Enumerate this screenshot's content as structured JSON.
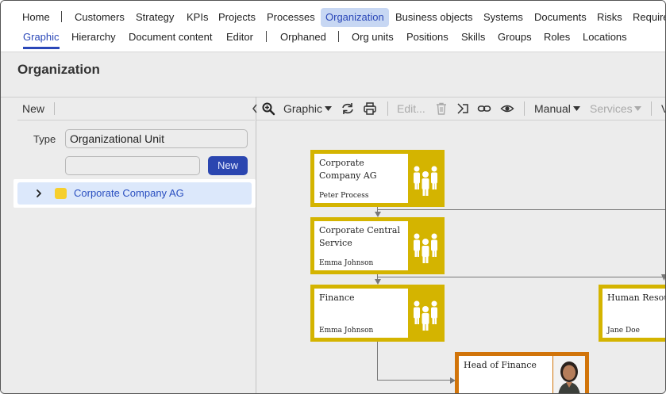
{
  "nav": {
    "main_items": [
      {
        "label": "Home"
      },
      {
        "label": "Customers"
      },
      {
        "label": "Strategy"
      },
      {
        "label": "KPIs"
      },
      {
        "label": "Projects"
      },
      {
        "label": "Processes"
      },
      {
        "label": "Organization",
        "active": true
      },
      {
        "label": "Business objects"
      },
      {
        "label": "Systems"
      },
      {
        "label": "Documents"
      },
      {
        "label": "Risks"
      },
      {
        "label": "Require"
      }
    ],
    "sub_items": [
      {
        "label": "Graphic",
        "active": true
      },
      {
        "label": "Hierarchy"
      },
      {
        "label": "Document content"
      },
      {
        "label": "Editor"
      },
      {
        "label": "Orphaned"
      },
      {
        "label": "Org units"
      },
      {
        "label": "Positions"
      },
      {
        "label": "Skills"
      },
      {
        "label": "Groups"
      },
      {
        "label": "Roles"
      },
      {
        "label": "Locations"
      }
    ]
  },
  "page": {
    "title": "Organization"
  },
  "left_panel": {
    "new_label": "New",
    "type_label": "Type",
    "type_value": "Organizational Unit",
    "name_value": "",
    "new_button": "New",
    "tree": [
      {
        "label": "Corporate Company AG",
        "color": "#f6cf2e"
      }
    ]
  },
  "toolbar": {
    "view_label": "Graphic",
    "edit_label": "Edit...",
    "layout_label": "Manual",
    "services_label": "Services"
  },
  "diagram": {
    "nodes": [
      {
        "name": "Corporate Company AG",
        "person": "Peter Process",
        "icon": "people-group-icon"
      },
      {
        "name": "Corporate Central Service",
        "person": "Emma Johnson",
        "icon": "people-group-icon"
      },
      {
        "name": "Finance",
        "person": "Emma Johnson",
        "icon": "people-group-icon"
      },
      {
        "name": "Human Resource",
        "person": "Jane Doe",
        "icon": "people-group-icon"
      },
      {
        "name": "Head of Finance",
        "person": "",
        "icon": "person-photo-icon"
      }
    ]
  },
  "colors": {
    "accent": "#2b46b0",
    "unit_node": "#d4b400",
    "position_node": "#d1740a",
    "tree_selected": "#dce8fb"
  }
}
